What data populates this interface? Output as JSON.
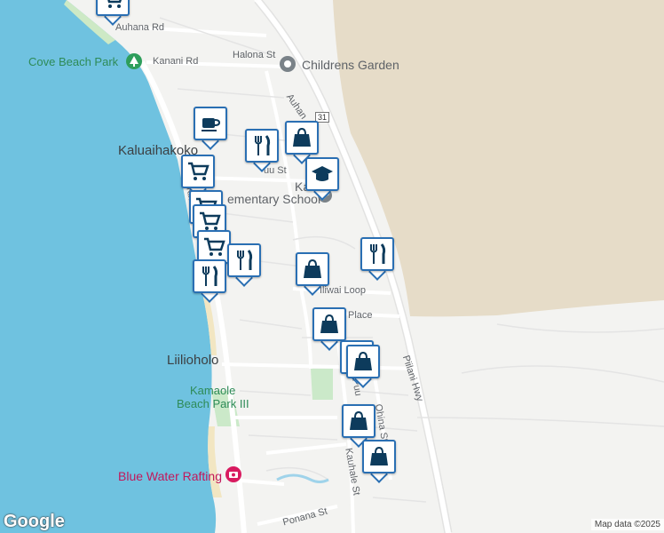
{
  "map": {
    "place_labels": {
      "kaluaihakoko": "Kaluaihakoko",
      "liiloholo": "Liilioholo",
      "kamali_school": "Kamali",
      "kamali_school_2": "ementary School"
    },
    "park_labels": {
      "cove_beach_park": "Cove Beach Park",
      "kamaole_1": "Kamaole",
      "kamaole_2": "Beach Park III"
    },
    "poi_labels": {
      "childrens_garden": "Childrens Garden",
      "blue_water_rafting": "Blue Water Rafting"
    },
    "road_labels": {
      "auhana_rd": "Auhana Rd",
      "kanani_rd": "Kanani Rd",
      "halona_st": "Halona St",
      "auhana_diag": "Auhan",
      "uu_st": "uu St",
      "iliwai_loop": "Iliwai Loop",
      "place": "Place",
      "piilani_hwy": "Piilani Hwy",
      "puu": "Puu",
      "ohina_st": "Ohina St",
      "kauhale_st": "Kauhale St",
      "ponana_st": "Ponana St",
      "s_kihei": "S Kihei",
      "hwy_31": "31",
      "a_st": "A"
    },
    "attribution": "Map data ©2025",
    "logo": "Google"
  },
  "markers": [
    {
      "type": "shopping-cart",
      "name": "cart-marker-top"
    },
    {
      "type": "coffee",
      "name": "coffee-marker"
    },
    {
      "type": "restaurant",
      "name": "restaurant-marker-1"
    },
    {
      "type": "shopping-bag",
      "name": "bag-marker-1"
    },
    {
      "type": "school",
      "name": "school-marker"
    },
    {
      "type": "shopping-cart",
      "name": "cart-marker-1"
    },
    {
      "type": "shopping-cart",
      "name": "cart-marker-2"
    },
    {
      "type": "shopping-cart",
      "name": "cart-marker-3"
    },
    {
      "type": "shopping-cart",
      "name": "cart-marker-4"
    },
    {
      "type": "restaurant",
      "name": "restaurant-marker-2"
    },
    {
      "type": "restaurant",
      "name": "restaurant-marker-3"
    },
    {
      "type": "shopping-bag",
      "name": "bag-marker-2"
    },
    {
      "type": "restaurant",
      "name": "restaurant-marker-4"
    },
    {
      "type": "shopping-bag",
      "name": "bag-marker-3"
    },
    {
      "type": "shopping-bag",
      "name": "bag-marker-4"
    },
    {
      "type": "shopping-bag",
      "name": "bag-marker-5"
    },
    {
      "type": "shopping-bag",
      "name": "bag-marker-6"
    },
    {
      "type": "shopping-bag",
      "name": "bag-marker-7"
    }
  ],
  "colors": {
    "ocean": "#6fc2e0",
    "land": "#f3f3f1",
    "hills": "#e6dcc8",
    "park": "#cbe9c9",
    "beach": "#f2e6c2",
    "marker_border": "#2a6fb3",
    "marker_icon": "#0d3b5c"
  }
}
